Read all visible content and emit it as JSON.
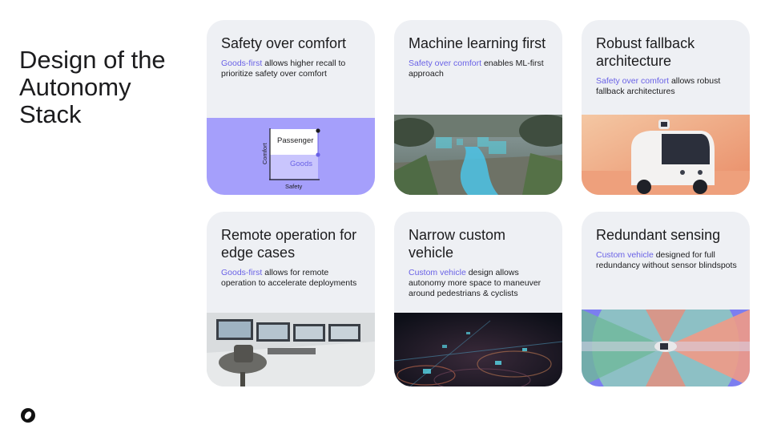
{
  "title": "Design of the Autonomy Stack",
  "cards": [
    {
      "title": "Safety over comfort",
      "highlight": "Goods-first",
      "desc": " allows higher recall to prioritize safety over comfort",
      "chart_data": {
        "type": "diagram",
        "xlabel": "Safety",
        "ylabel": "Comfort",
        "labels": [
          "Passenger",
          "Goods"
        ]
      }
    },
    {
      "title": "Machine learning first",
      "highlight": "Safety over comfort",
      "desc": " enables ML-first approach"
    },
    {
      "title": "Robust fallback architecture",
      "highlight": "Safety over comfort",
      "desc": " allows robust fallback architectures"
    },
    {
      "title": "Remote operation for edge cases",
      "highlight": "Goods-first",
      "desc": " allows for remote operation to accelerate deployments"
    },
    {
      "title": "Narrow custom vehicle",
      "highlight": "Custom vehicle",
      "desc": " design allows autonomy more space to maneuver around pedestrians & cyclists"
    },
    {
      "title": "Redundant sensing",
      "highlight": "Custom vehicle",
      "desc": " designed for full redundancy without sensor blindspots"
    }
  ],
  "colors": {
    "accent": "#6a62e6",
    "card_bg": "#eef0f4",
    "diagram_bg": "#a59ffb"
  },
  "icons": {
    "logo": "ring-logo-icon"
  }
}
